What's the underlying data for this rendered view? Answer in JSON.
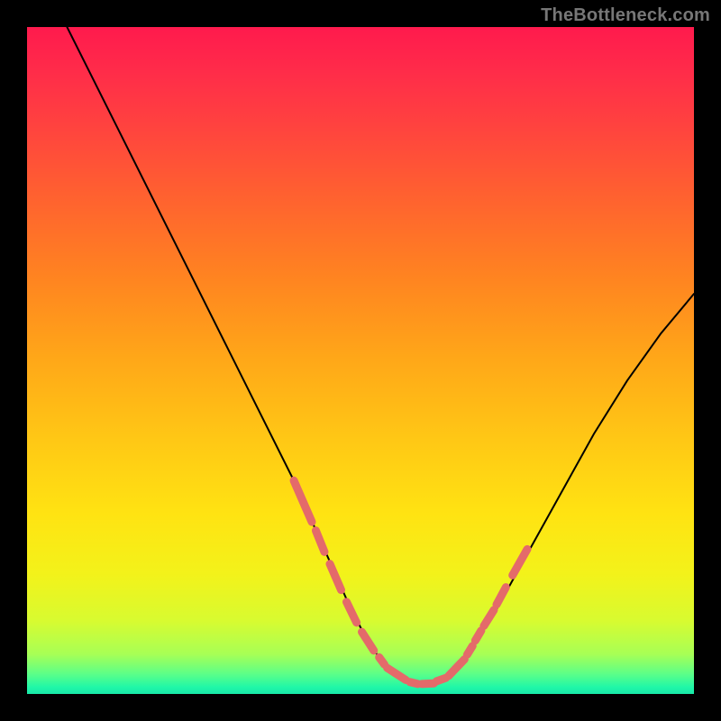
{
  "watermark": "TheBottleneck.com",
  "colors": {
    "frame": "#000000",
    "curve": "#000000",
    "dash": "#e46a6a"
  },
  "chart_data": {
    "type": "line",
    "title": "",
    "xlabel": "",
    "ylabel": "",
    "xlim": [
      0,
      100
    ],
    "ylim": [
      0,
      100
    ],
    "grid": false,
    "legend": false,
    "series": [
      {
        "name": "bottleneck-curve",
        "x": [
          6,
          10,
          15,
          20,
          25,
          30,
          35,
          40,
          44,
          48,
          51,
          53.5,
          56,
          58.5,
          61,
          63,
          65.5,
          70,
          75,
          80,
          85,
          90,
          95,
          100
        ],
        "y": [
          100,
          92,
          82,
          72,
          62,
          52,
          42,
          32,
          23,
          14,
          8,
          4.5,
          2.5,
          1.5,
          1.5,
          2.5,
          5,
          12,
          21,
          30,
          39,
          47,
          54,
          60
        ]
      }
    ],
    "highlight_segments": [
      {
        "x": [
          40,
          42.7
        ],
        "y": [
          32,
          25.8
        ]
      },
      {
        "x": [
          43.3,
          44.6
        ],
        "y": [
          24.5,
          21.3
        ]
      },
      {
        "x": [
          45.4,
          47.1
        ],
        "y": [
          19.5,
          15.6
        ]
      },
      {
        "x": [
          47.9,
          49.4
        ],
        "y": [
          13.8,
          10.7
        ]
      },
      {
        "x": [
          50.2,
          52.0
        ],
        "y": [
          9.3,
          6.5
        ]
      },
      {
        "x": [
          52.8,
          53.6
        ],
        "y": [
          5.5,
          4.4
        ]
      },
      {
        "x": [
          54.0,
          56.8
        ],
        "y": [
          3.9,
          2.1
        ]
      },
      {
        "x": [
          57.4,
          58.6
        ],
        "y": [
          1.8,
          1.5
        ]
      },
      {
        "x": [
          59.2,
          61.0
        ],
        "y": [
          1.5,
          1.6
        ]
      },
      {
        "x": [
          61.4,
          62.8
        ],
        "y": [
          1.9,
          2.4
        ]
      },
      {
        "x": [
          63.2,
          65.6
        ],
        "y": [
          2.7,
          5.2
        ]
      },
      {
        "x": [
          66.0,
          66.8
        ],
        "y": [
          5.9,
          7.2
        ]
      },
      {
        "x": [
          67.2,
          68.1
        ],
        "y": [
          8.0,
          9.5
        ]
      },
      {
        "x": [
          68.5,
          70.0
        ],
        "y": [
          10.2,
          12.6
        ]
      },
      {
        "x": [
          70.4,
          71.8
        ],
        "y": [
          13.4,
          16.0
        ]
      },
      {
        "x": [
          72.8,
          75.0
        ],
        "y": [
          17.8,
          21.7
        ]
      }
    ]
  }
}
